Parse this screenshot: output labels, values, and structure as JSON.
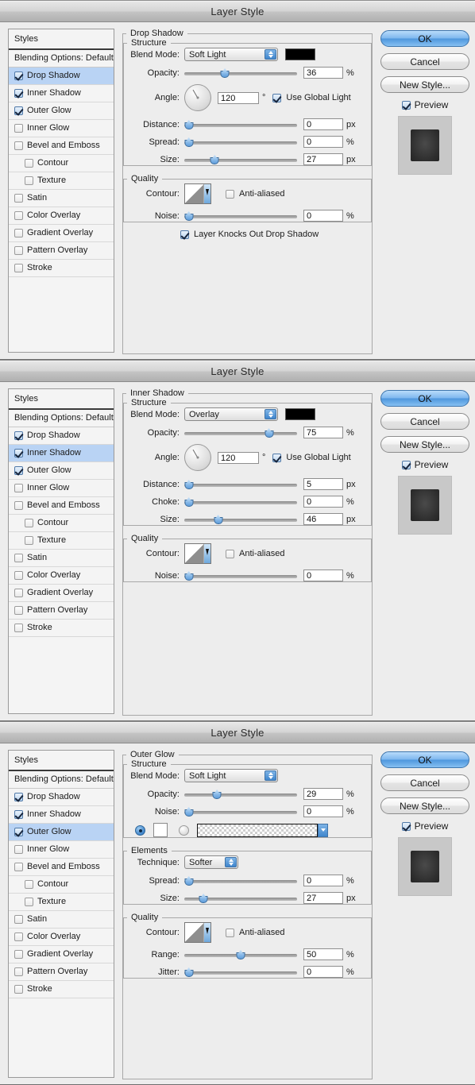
{
  "window": {
    "title": "Layer Style"
  },
  "buttons": {
    "ok": "OK",
    "cancel": "Cancel",
    "new_style": "New Style...",
    "preview": "Preview"
  },
  "styles_panel": {
    "header": "Styles",
    "blending_options": "Blending Options: Default",
    "effects": [
      {
        "label": "Drop Shadow",
        "checked": true,
        "indent": false
      },
      {
        "label": "Inner Shadow",
        "checked": true,
        "indent": false
      },
      {
        "label": "Outer Glow",
        "checked": true,
        "indent": false
      },
      {
        "label": "Inner Glow",
        "checked": false,
        "indent": false
      },
      {
        "label": "Bevel and Emboss",
        "checked": false,
        "indent": false
      },
      {
        "label": "Contour",
        "checked": false,
        "indent": true
      },
      {
        "label": "Texture",
        "checked": false,
        "indent": true
      },
      {
        "label": "Satin",
        "checked": false,
        "indent": false
      },
      {
        "label": "Color Overlay",
        "checked": false,
        "indent": false
      },
      {
        "label": "Gradient Overlay",
        "checked": false,
        "indent": false
      },
      {
        "label": "Pattern Overlay",
        "checked": false,
        "indent": false
      },
      {
        "label": "Stroke",
        "checked": false,
        "indent": false
      }
    ]
  },
  "panel1": {
    "section_title": "Drop Shadow",
    "selected_effect": "Drop Shadow",
    "structure_title": "Structure",
    "quality_title": "Quality",
    "blend_mode_label": "Blend Mode:",
    "blend_mode_value": "Soft Light",
    "blend_color": "#000000",
    "opacity_label": "Opacity:",
    "opacity_value": "36",
    "opacity_unit": "%",
    "opacity_pct": 36,
    "angle_label": "Angle:",
    "angle_value": "120",
    "angle_unit": "°",
    "use_global_light": "Use Global Light",
    "use_global_light_checked": true,
    "distance_label": "Distance:",
    "distance_value": "0",
    "distance_unit": "px",
    "distance_pct": 0,
    "spread_label": "Spread:",
    "spread_value": "0",
    "spread_unit": "%",
    "spread_pct": 0,
    "size_label": "Size:",
    "size_value": "27",
    "size_unit": "px",
    "size_pct": 27,
    "contour_label": "Contour:",
    "anti_aliased": "Anti-aliased",
    "anti_aliased_checked": false,
    "noise_label": "Noise:",
    "noise_value": "0",
    "noise_unit": "%",
    "noise_pct": 0,
    "knockout_label": "Layer Knocks Out Drop Shadow",
    "knockout_checked": true
  },
  "panel2": {
    "section_title": "Inner Shadow",
    "selected_effect": "Inner Shadow",
    "structure_title": "Structure",
    "quality_title": "Quality",
    "blend_mode_label": "Blend Mode:",
    "blend_mode_value": "Overlay",
    "blend_color": "#000000",
    "opacity_label": "Opacity:",
    "opacity_value": "75",
    "opacity_unit": "%",
    "opacity_pct": 75,
    "angle_label": "Angle:",
    "angle_value": "120",
    "angle_unit": "°",
    "use_global_light": "Use Global Light",
    "use_global_light_checked": true,
    "distance_label": "Distance:",
    "distance_value": "5",
    "distance_unit": "px",
    "distance_pct": 3,
    "choke_label": "Choke:",
    "choke_value": "0",
    "choke_unit": "%",
    "choke_pct": 0,
    "size_label": "Size:",
    "size_value": "46",
    "size_unit": "px",
    "size_pct": 30,
    "contour_label": "Contour:",
    "anti_aliased": "Anti-aliased",
    "anti_aliased_checked": false,
    "noise_label": "Noise:",
    "noise_value": "0",
    "noise_unit": "%",
    "noise_pct": 0
  },
  "panel3": {
    "section_title": "Outer Glow",
    "selected_effect": "Outer Glow",
    "structure_title": "Structure",
    "elements_title": "Elements",
    "quality_title": "Quality",
    "blend_mode_label": "Blend Mode:",
    "blend_mode_value": "Soft Light",
    "opacity_label": "Opacity:",
    "opacity_value": "29",
    "opacity_unit": "%",
    "opacity_pct": 29,
    "noise_label": "Noise:",
    "noise_value": "0",
    "noise_unit": "%",
    "noise_pct": 0,
    "fill_color_selected": true,
    "fill_color_swatch": "#ffffff",
    "fill_gradient_selected": false,
    "technique_label": "Technique:",
    "technique_value": "Softer",
    "spread_label": "Spread:",
    "spread_value": "0",
    "spread_unit": "%",
    "spread_pct": 0,
    "size_label": "Size:",
    "size_value": "27",
    "size_unit": "px",
    "size_pct": 17,
    "contour_label": "Contour:",
    "anti_aliased": "Anti-aliased",
    "anti_aliased_checked": false,
    "range_label": "Range:",
    "range_value": "50",
    "range_unit": "%",
    "range_pct": 50,
    "jitter_label": "Jitter:",
    "jitter_value": "0",
    "jitter_unit": "%",
    "jitter_pct": 0
  }
}
